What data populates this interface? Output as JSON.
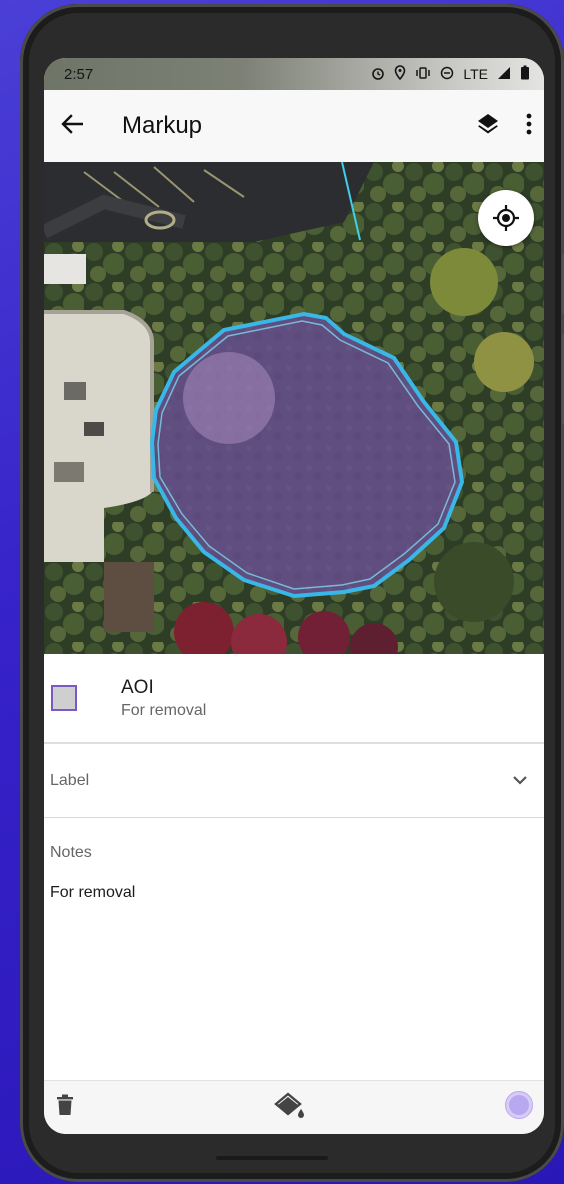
{
  "status_bar": {
    "time": "2:57",
    "network": "LTE"
  },
  "app_bar": {
    "title": "Markup"
  },
  "feature": {
    "name": "AOI",
    "subtitle": "For removal",
    "swatch_fill": "#cfcfcf",
    "swatch_border": "#7a58c8"
  },
  "label_field": {
    "label": "Label"
  },
  "notes": {
    "label": "Notes",
    "value": "For removal"
  },
  "colors": {
    "outline": "#39b8e8",
    "fill": "#7b5fb9",
    "accent": "#b8a8f0"
  },
  "icons": [
    "back-arrow-icon",
    "layers-icon",
    "more-vert-icon",
    "locate-icon",
    "chevron-down-icon",
    "trash-icon",
    "paint-bucket-icon",
    "color-dot-icon",
    "alarm-icon",
    "location-pin-icon",
    "vibrate-icon",
    "do-not-disturb-icon",
    "signal-icon",
    "battery-icon"
  ]
}
